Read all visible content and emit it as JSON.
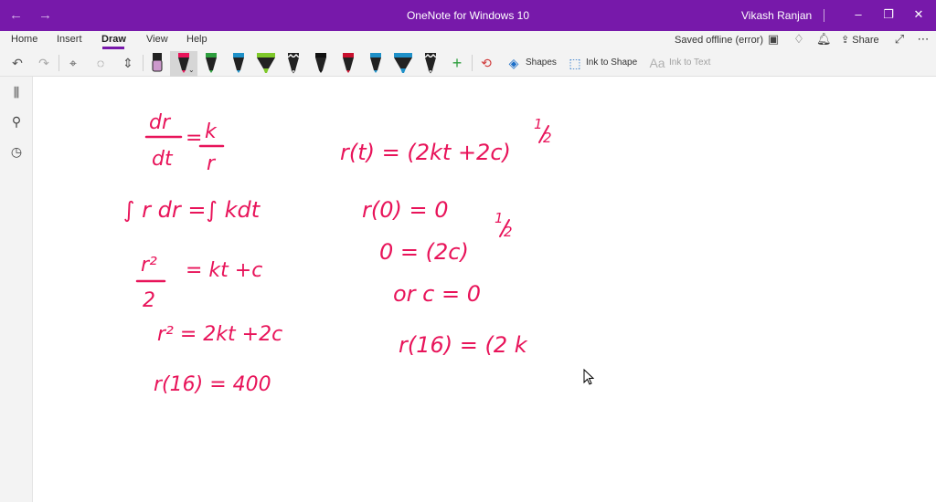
{
  "window": {
    "title": "OneNote for Windows 10",
    "user": "Vikash Ranjan",
    "back_icon": "back-arrow-icon",
    "forward_icon": "forward-arrow-icon",
    "accent_color": "#7719aa"
  },
  "menu": {
    "tabs": [
      "Home",
      "Insert",
      "Draw",
      "View",
      "Help"
    ],
    "active_tab": "Draw",
    "status": "Saved offline (error)",
    "share_label": "Share"
  },
  "toolbar": {
    "shapes_label": "Shapes",
    "ink_to_shape_label": "Ink to Shape",
    "ink_to_text_label": "Ink to Text",
    "pen_colors": [
      "#cc99cc",
      "#e8145a",
      "#2e9e3e",
      "#1e90c8",
      "#7ec82a",
      "#ffffff",
      "#111111",
      "#c8102e",
      "#1e90c8",
      "#1e90c8",
      "#ffffff"
    ],
    "ink_color": "#e8145a"
  },
  "note": {
    "left_column": [
      "dr/dt = k/r",
      "∫ r dr = ∫ k dt",
      "r²/2 = kt + c",
      "r² = 2kt + 2c",
      "r(16) = 400"
    ],
    "right_column": [
      "r(t) = (2kt + 2c)^½",
      "r(0) = 0",
      "0 = (2c)^½",
      "or c = 0",
      "r(16) = (2k"
    ]
  }
}
